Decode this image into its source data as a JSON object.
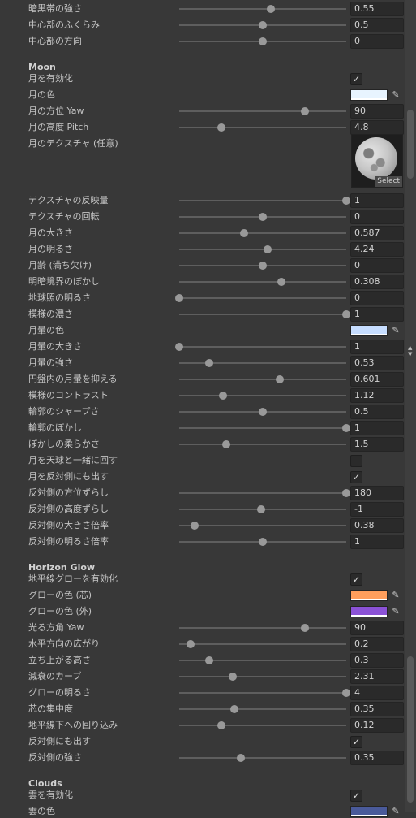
{
  "rows": [
    {
      "type": "slider",
      "label": "暗黒帯の強さ",
      "value": "0.55",
      "pos": 0.55
    },
    {
      "type": "slider",
      "label": "中心部のふくらみ",
      "value": "0.5",
      "pos": 0.5
    },
    {
      "type": "slider",
      "label": "中心部の方向",
      "value": "0",
      "pos": 0.5
    },
    {
      "type": "header",
      "label": "Moon"
    },
    {
      "type": "check",
      "label": "月を有効化",
      "checked": true
    },
    {
      "type": "color",
      "label": "月の色",
      "color": "#e8f4ff"
    },
    {
      "type": "slider",
      "label": "月の方位 Yaw",
      "value": "90",
      "pos": 0.75
    },
    {
      "type": "slider",
      "label": "月の高度 Pitch",
      "value": "4.8",
      "pos": 0.25
    },
    {
      "type": "texture",
      "label": "月のテクスチャ (任意)",
      "button": "Select"
    },
    {
      "type": "slider",
      "label": "テクスチャの反映量",
      "value": "1",
      "pos": 1.0
    },
    {
      "type": "slider",
      "label": "テクスチャの回転",
      "value": "0",
      "pos": 0.5
    },
    {
      "type": "slider",
      "label": "月の大きさ",
      "value": "0.587",
      "pos": 0.39
    },
    {
      "type": "slider",
      "label": "月の明るさ",
      "value": "4.24",
      "pos": 0.53
    },
    {
      "type": "slider",
      "label": "月齢 (満ち欠け)",
      "value": "0",
      "pos": 0.5
    },
    {
      "type": "slider",
      "label": "明暗境界のぼかし",
      "value": "0.308",
      "pos": 0.61
    },
    {
      "type": "slider",
      "label": "地球照の明るさ",
      "value": "0",
      "pos": 0.0
    },
    {
      "type": "slider",
      "label": "模様の濃さ",
      "value": "1",
      "pos": 1.0
    },
    {
      "type": "color",
      "label": "月暈の色",
      "color": "#c6ddff"
    },
    {
      "type": "slider",
      "label": "月暈の大きさ",
      "value": "1",
      "pos": 0.0
    },
    {
      "type": "slider",
      "label": "月暈の強さ",
      "value": "0.53",
      "pos": 0.18
    },
    {
      "type": "slider",
      "label": "円盤内の月暈を抑える",
      "value": "0.601",
      "pos": 0.6
    },
    {
      "type": "slider",
      "label": "模様のコントラスト",
      "value": "1.12",
      "pos": 0.26
    },
    {
      "type": "slider",
      "label": "輪郭のシャープさ",
      "value": "0.5",
      "pos": 0.5
    },
    {
      "type": "slider",
      "label": "輪郭のぼかし",
      "value": "1",
      "pos": 1.0
    },
    {
      "type": "slider",
      "label": "ぼかしの柔らかさ",
      "value": "1.5",
      "pos": 0.28
    },
    {
      "type": "check",
      "label": "月を天球と一緒に回す",
      "checked": false
    },
    {
      "type": "check",
      "label": "月を反対側にも出す",
      "checked": true
    },
    {
      "type": "slider",
      "label": "反対側の方位ずらし",
      "value": "180",
      "pos": 1.0
    },
    {
      "type": "slider",
      "label": "反対側の高度ずらし",
      "value": "-1",
      "pos": 0.49
    },
    {
      "type": "slider",
      "label": "反対側の大きさ倍率",
      "value": "0.38",
      "pos": 0.09
    },
    {
      "type": "slider",
      "label": "反対側の明るさ倍率",
      "value": "1",
      "pos": 0.5
    },
    {
      "type": "header",
      "label": "Horizon Glow"
    },
    {
      "type": "check",
      "label": "地平線グローを有効化",
      "checked": true
    },
    {
      "type": "color",
      "label": "グローの色 (芯)",
      "color": "#ff9e5c"
    },
    {
      "type": "color",
      "label": "グローの色 (外)",
      "color": "#8b52d6"
    },
    {
      "type": "slider",
      "label": "光る方角 Yaw",
      "value": "90",
      "pos": 0.75
    },
    {
      "type": "slider",
      "label": "水平方向の広がり",
      "value": "0.2",
      "pos": 0.07
    },
    {
      "type": "slider",
      "label": "立ち上がる高さ",
      "value": "0.3",
      "pos": 0.18
    },
    {
      "type": "slider",
      "label": "減衰のカーブ",
      "value": "2.31",
      "pos": 0.32
    },
    {
      "type": "slider",
      "label": "グローの明るさ",
      "value": "4",
      "pos": 1.0
    },
    {
      "type": "slider",
      "label": "芯の集中度",
      "value": "0.35",
      "pos": 0.33
    },
    {
      "type": "slider",
      "label": "地平線下への回り込み",
      "value": "0.12",
      "pos": 0.25
    },
    {
      "type": "check",
      "label": "反対側にも出す",
      "checked": true
    },
    {
      "type": "slider",
      "label": "反対側の強さ",
      "value": "0.35",
      "pos": 0.37
    },
    {
      "type": "header",
      "label": "Clouds"
    },
    {
      "type": "check",
      "label": "雲を有効化",
      "checked": true
    },
    {
      "type": "color",
      "label": "雲の色",
      "color": "#4a5a9a"
    }
  ],
  "glyphs": {
    "check": "✓",
    "picker": "✎",
    "up": "▲",
    "down": "▼"
  }
}
